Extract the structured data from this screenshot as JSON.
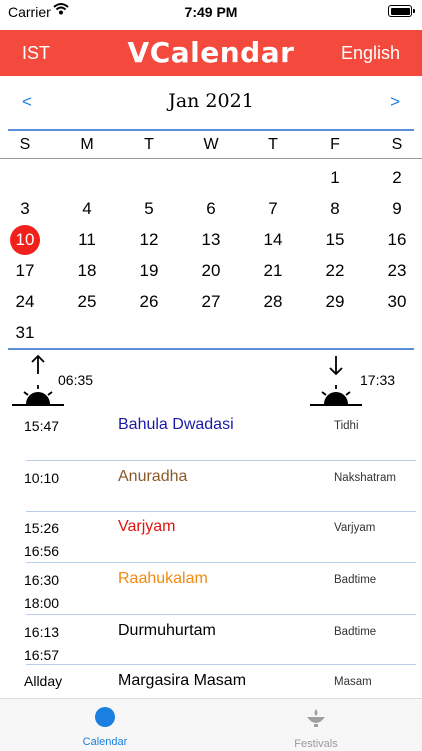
{
  "status": {
    "carrier": "Carrier",
    "time": "7:49 PM"
  },
  "appbar": {
    "timezone": "IST",
    "title": "VCalendar",
    "language": "English",
    "color": "#f44a3e"
  },
  "month": {
    "prev": "<",
    "label": "Jan 2021",
    "next": ">"
  },
  "weekdays": [
    "S",
    "M",
    "T",
    "W",
    "T",
    "F",
    "S"
  ],
  "days": [
    [
      "",
      "",
      "",
      "",
      "",
      "1",
      "2"
    ],
    [
      "3",
      "4",
      "5",
      "6",
      "7",
      "8",
      "9"
    ],
    [
      "10",
      "11",
      "12",
      "13",
      "14",
      "15",
      "16"
    ],
    [
      "17",
      "18",
      "19",
      "20",
      "21",
      "22",
      "23"
    ],
    [
      "24",
      "25",
      "26",
      "27",
      "28",
      "29",
      "30"
    ],
    [
      "31",
      "",
      "",
      "",
      "",
      "",
      ""
    ]
  ],
  "today": "10",
  "sun": {
    "rise": "06:35",
    "set": "17:33"
  },
  "events": [
    {
      "time1": "15:47",
      "time2": "",
      "name": "Bahula Dwadasi",
      "type": "Tidhi",
      "color": "#1a1aa6"
    },
    {
      "time1": "10:10",
      "time2": "",
      "name": "Anuradha",
      "type": "Nakshatram",
      "color": "#8a5a2b"
    },
    {
      "time1": "15:26",
      "time2": "16:56",
      "name": "Varjyam",
      "type": "Varjyam",
      "color": "#e0140e"
    },
    {
      "time1": "16:30",
      "time2": "18:00",
      "name": "Raahukalam",
      "type": "Badtime",
      "color": "#f08a10"
    },
    {
      "time1": "16:13",
      "time2": "16:57",
      "name": "Durmuhurtam",
      "type": "Badtime",
      "color": "#000000"
    },
    {
      "time1": "Allday",
      "time2": "",
      "name": "Margasira Masam",
      "type": "Masam",
      "color": "#000000"
    }
  ],
  "tabs": {
    "calendar": "Calendar",
    "festivals": "Festivals",
    "active_color": "#1a7fe0"
  }
}
